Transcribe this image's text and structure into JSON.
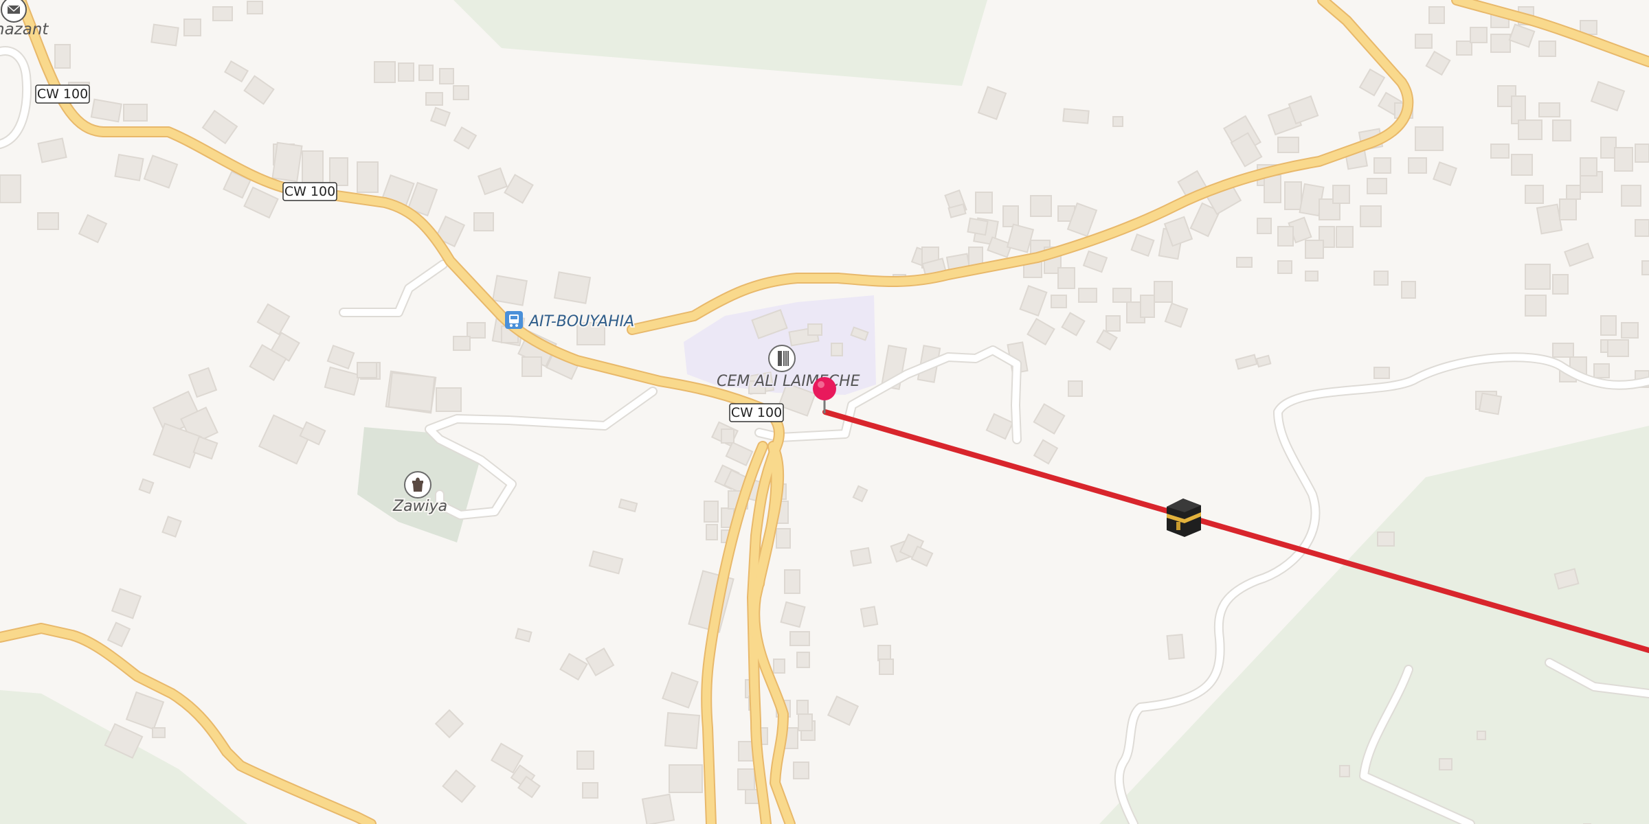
{
  "map": {
    "road_ref": "CW 100",
    "labels": {
      "bus_stop": "AIT-BOUYAHIA",
      "school": "CEM ALI LAIMECHE",
      "zawiya": "Zawiya",
      "partial_place": "nazant"
    },
    "icons": {
      "bus_stop": "bus-stop-icon",
      "school": "school-icon",
      "zawiya": "zawiya-icon",
      "post": "envelope-icon",
      "marker": "location-pin-icon",
      "kaaba": "kaaba-icon"
    },
    "colors": {
      "background": "#f8f6f3",
      "primary_road": "#f9d98c",
      "primary_road_casing": "#e8b86a",
      "minor_road": "#ffffff",
      "minor_road_casing": "#dedbd6",
      "building": "#eae6e1",
      "building_edge": "#ddd8d2",
      "forest": "#e8eee2",
      "school_area": "#ece8f6",
      "cemetery_area": "#dce3d8",
      "qibla_line": "#d8252c",
      "pin": "#e8195c",
      "label_text": "#555555",
      "bus_label_text": "#2f5d8a"
    }
  }
}
